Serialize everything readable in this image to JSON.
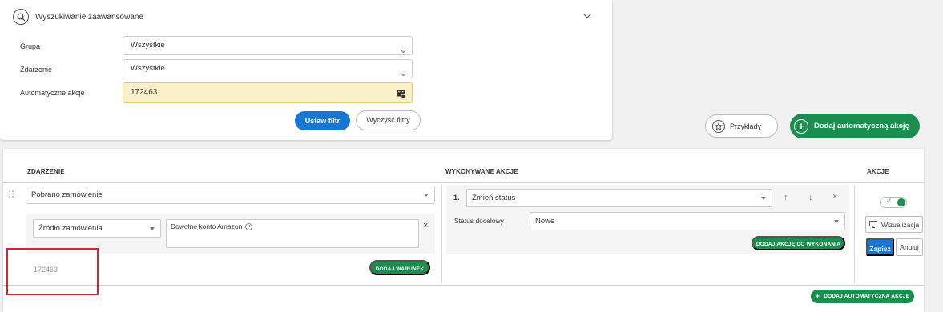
{
  "filter": {
    "title": "Wyszukiwanie zaawansowane",
    "rows": [
      {
        "label": "Grupa",
        "value": "Wszystkie"
      },
      {
        "label": "Zdarzenie",
        "value": "Wszystkie"
      },
      {
        "label": "Automatyczne akcje",
        "value": "172463"
      }
    ],
    "apply_label": "Ustaw filtr",
    "clear_label": "Wyczyść filtry"
  },
  "toolbar": {
    "examples_label": "Przykłady",
    "add_auto_label": "Dodaj automatyczną akcję"
  },
  "table": {
    "col_event": "ZDARZENIE",
    "col_actions": "WYKONYWANE AKCJE",
    "col_akcje": "AKCJE",
    "event_value": "Pobrano zamówienie",
    "condition_field": "Źródło zamówienia",
    "condition_tag": "Dowolne konto Amazon",
    "add_condition_label": "DODAJ WARUNEK",
    "rule_id": "172463",
    "action_number": "1.",
    "action_value": "Zmień status",
    "status_label": "Status docelowy",
    "status_value": "Nowe",
    "add_action_label": "DODAJ AKCJĘ DO WYKONANIA",
    "preview_label": "Wizualizacja",
    "save_label": "Zapisz",
    "cancel_label": "Anuluj",
    "add_auto_bottom_label": "DODAJ AUTOMATYCZNĄ AKCJĘ"
  },
  "colors": {
    "primary": "#1877d2",
    "success": "#1b8e4f",
    "highlight_bg": "#fbf1c8",
    "annotation": "#d8232a"
  }
}
